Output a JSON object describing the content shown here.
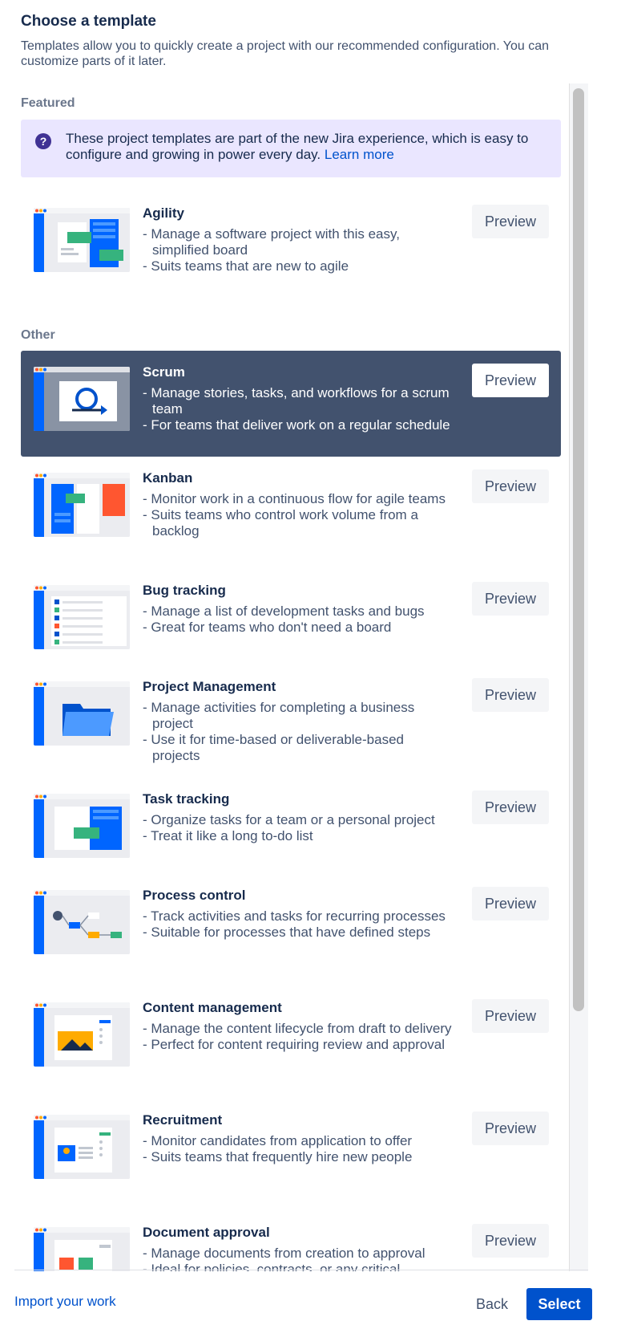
{
  "header": {
    "title": "Choose a template",
    "description": "Templates allow you to quickly create a project with our recommended configuration. You can customize parts of it later."
  },
  "sections": {
    "featured": "Featured",
    "other": "Other"
  },
  "info_panel": {
    "icon": "question-icon",
    "text": "These project templates are part of the new Jira experience, which is easy to configure and growing in power every day. ",
    "link": "Learn more"
  },
  "preview_label": "Preview",
  "featured_templates": [
    {
      "name": "Agility",
      "bullets": [
        "Manage a software project with this easy, simplified board",
        "Suits teams that are new to agile"
      ]
    }
  ],
  "other_templates": [
    {
      "name": "Scrum",
      "selected": true,
      "bullets": [
        "Manage stories, tasks, and workflows for a scrum team",
        "For teams that deliver work on a regular schedule"
      ]
    },
    {
      "name": "Kanban",
      "bullets": [
        "Monitor work in a continuous flow for agile teams",
        "Suits teams who control work volume from a backlog"
      ]
    },
    {
      "name": "Bug tracking",
      "bullets": [
        "Manage a list of development tasks and bugs",
        "Great for teams who don't need a board"
      ]
    },
    {
      "name": "Project Management",
      "bullets": [
        "Manage activities for completing a business project",
        "Use it for time-based or deliverable-based projects"
      ]
    },
    {
      "name": "Task tracking",
      "bullets": [
        "Organize tasks for a team or a personal project",
        "Treat it like a long to-do list"
      ]
    },
    {
      "name": "Process control",
      "bullets": [
        "Track activities and tasks for recurring processes",
        "Suitable for processes that have defined steps"
      ]
    },
    {
      "name": "Content management",
      "bullets": [
        "Manage the content lifecycle from draft to delivery",
        "Perfect for content requiring review and approval"
      ]
    },
    {
      "name": "Recruitment",
      "bullets": [
        "Monitor candidates from application to offer",
        "Suits teams that frequently hire new people"
      ]
    },
    {
      "name": "Document approval",
      "bullets": [
        "Manage documents from creation to approval",
        "Ideal for policies, contracts, or any critical"
      ]
    }
  ],
  "footer": {
    "import_link": "Import your work",
    "back_label": "Back",
    "select_label": "Select"
  },
  "colors": {
    "primary": "#0052CC",
    "selected_bg": "#42526E",
    "info_bg": "#EAE6FF"
  }
}
